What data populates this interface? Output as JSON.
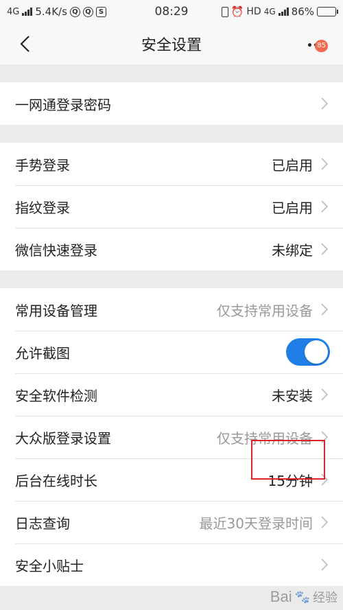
{
  "status_bar": {
    "network": "4G",
    "speed": "5.4K/s",
    "time": "08:29",
    "hd": "HD",
    "network_right": "4G",
    "battery": "86%",
    "battery_level": 0.86
  },
  "nav": {
    "title": "安全设置",
    "badge": "85"
  },
  "groups": [
    {
      "rows": [
        {
          "label": "一网通登录密码",
          "value": ""
        }
      ]
    },
    {
      "rows": [
        {
          "label": "手势登录",
          "value": "已启用"
        },
        {
          "label": "指纹登录",
          "value": "已启用"
        },
        {
          "label": "微信快速登录",
          "value": "未绑定"
        }
      ]
    },
    {
      "rows": [
        {
          "label": "常用设备管理",
          "value": "仅支持常用设备"
        },
        {
          "label": "允许截图",
          "toggle_on": true
        },
        {
          "label": "安全软件检测",
          "value": "未安装"
        },
        {
          "label": "大众版登录设置",
          "value": "仅支持常用设备"
        },
        {
          "label": "后台在线时长",
          "value": "15分钟"
        },
        {
          "label": "日志查询",
          "value": "最近30天登录时间"
        },
        {
          "label": "安全小贴士",
          "value": ""
        }
      ]
    }
  ],
  "colors": {
    "accent": "#1f7fe6",
    "highlight": "#d9232a",
    "badge": "#f26b4f"
  },
  "watermark": {
    "text": "Bai",
    "text2": "经验"
  }
}
